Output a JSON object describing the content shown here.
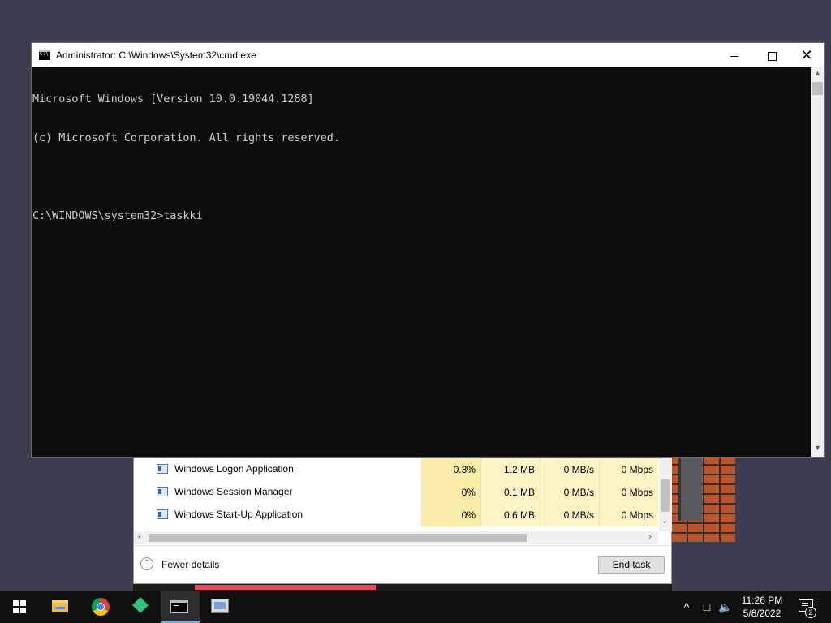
{
  "cmd_window": {
    "title": "Administrator: C:\\Windows\\System32\\cmd.exe",
    "controls": {
      "minimize": "—",
      "maximize": "☐",
      "close": "✕"
    },
    "console_lines": [
      "Microsoft Windows [Version 10.0.19044.1288]",
      "(c) Microsoft Corporation. All rights reserved.",
      "",
      "C:\\WINDOWS\\system32>taskki"
    ]
  },
  "task_manager": {
    "rows": [
      {
        "name": "Windows Logon Application",
        "cpu": "0.3%",
        "memory": "1.2 MB",
        "disk": "0 MB/s",
        "network": "0 Mbps"
      },
      {
        "name": "Windows Session Manager",
        "cpu": "0%",
        "memory": "0.1 MB",
        "disk": "0 MB/s",
        "network": "0 Mbps"
      },
      {
        "name": "Windows Start-Up Application",
        "cpu": "0%",
        "memory": "0.6 MB",
        "disk": "0 MB/s",
        "network": "0 Mbps"
      }
    ],
    "fewer_details_label": "Fewer details",
    "end_task_label": "End task"
  },
  "taskbar": {
    "pinned": [
      {
        "name": "start",
        "icon": "windows-logo-icon"
      },
      {
        "name": "file-explorer",
        "icon": "folder-icon"
      },
      {
        "name": "chrome",
        "icon": "chrome-icon"
      },
      {
        "name": "app-green",
        "icon": "green-diamond-icon"
      },
      {
        "name": "cmd",
        "icon": "command-prompt-icon",
        "active": true
      },
      {
        "name": "remote-desktop",
        "icon": "remote-desktop-icon"
      }
    ],
    "tray": {
      "chevron": "^",
      "time": "11:26 PM",
      "date": "5/8/2022",
      "notification_count": "2"
    }
  }
}
